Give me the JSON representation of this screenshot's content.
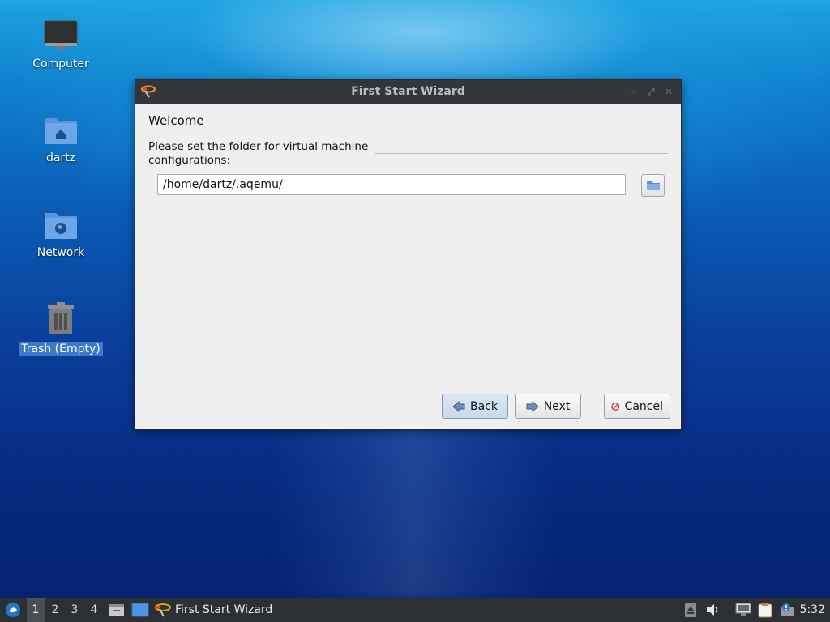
{
  "desktop": {
    "icons": [
      {
        "label": "Computer",
        "icon": "monitor-icon"
      },
      {
        "label": "dartz",
        "icon": "home-folder-icon"
      },
      {
        "label": "Network",
        "icon": "network-folder-icon"
      },
      {
        "label": "Trash (Empty)",
        "icon": "trash-icon",
        "selected": true
      }
    ]
  },
  "window": {
    "title": "First Start Wizard",
    "page_heading": "Welcome",
    "folder_label": "Please set the folder for virtual machine configurations:",
    "folder_value": "/home/dartz/.aqemu/",
    "buttons": {
      "back": "Back",
      "next": "Next",
      "cancel": "Cancel"
    }
  },
  "taskbar": {
    "workspaces": [
      "1",
      "2",
      "3",
      "4"
    ],
    "active_workspace": "1",
    "task_title": "First Start Wizard",
    "clock": "5:32"
  },
  "colors": {
    "titlebar": "#33373c",
    "selection": "#3d78c9",
    "taskbar": "#2c3035"
  }
}
